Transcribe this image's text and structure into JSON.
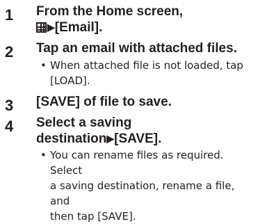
{
  "steps": [
    {
      "number": "1",
      "heading_line1": "From the Home screen,",
      "heading_line2_icon": "grid-menu-icon",
      "heading_line2_arrow": "▶",
      "heading_line2_text": "[Email]."
    },
    {
      "number": "2",
      "heading": "Tap an email with attached files.",
      "note_bullet": "•",
      "note_line1": "When attached file is not loaded, tap",
      "note_line2": "[LOAD]."
    },
    {
      "number": "3",
      "heading": "[SAVE] of file to save."
    },
    {
      "number": "4",
      "heading_line1": "Select a saving",
      "heading_line2_text": "destination",
      "heading_line2_arrow": "▶",
      "heading_line2_suffix": "[SAVE].",
      "note_bullet": "•",
      "note_line1": "You can rename files as required. Select",
      "note_line2": "a saving destination, rename a file, and",
      "note_line3": "then tap [SAVE]."
    }
  ],
  "colors": {
    "text": "#231f20",
    "background": "#ffffff"
  }
}
